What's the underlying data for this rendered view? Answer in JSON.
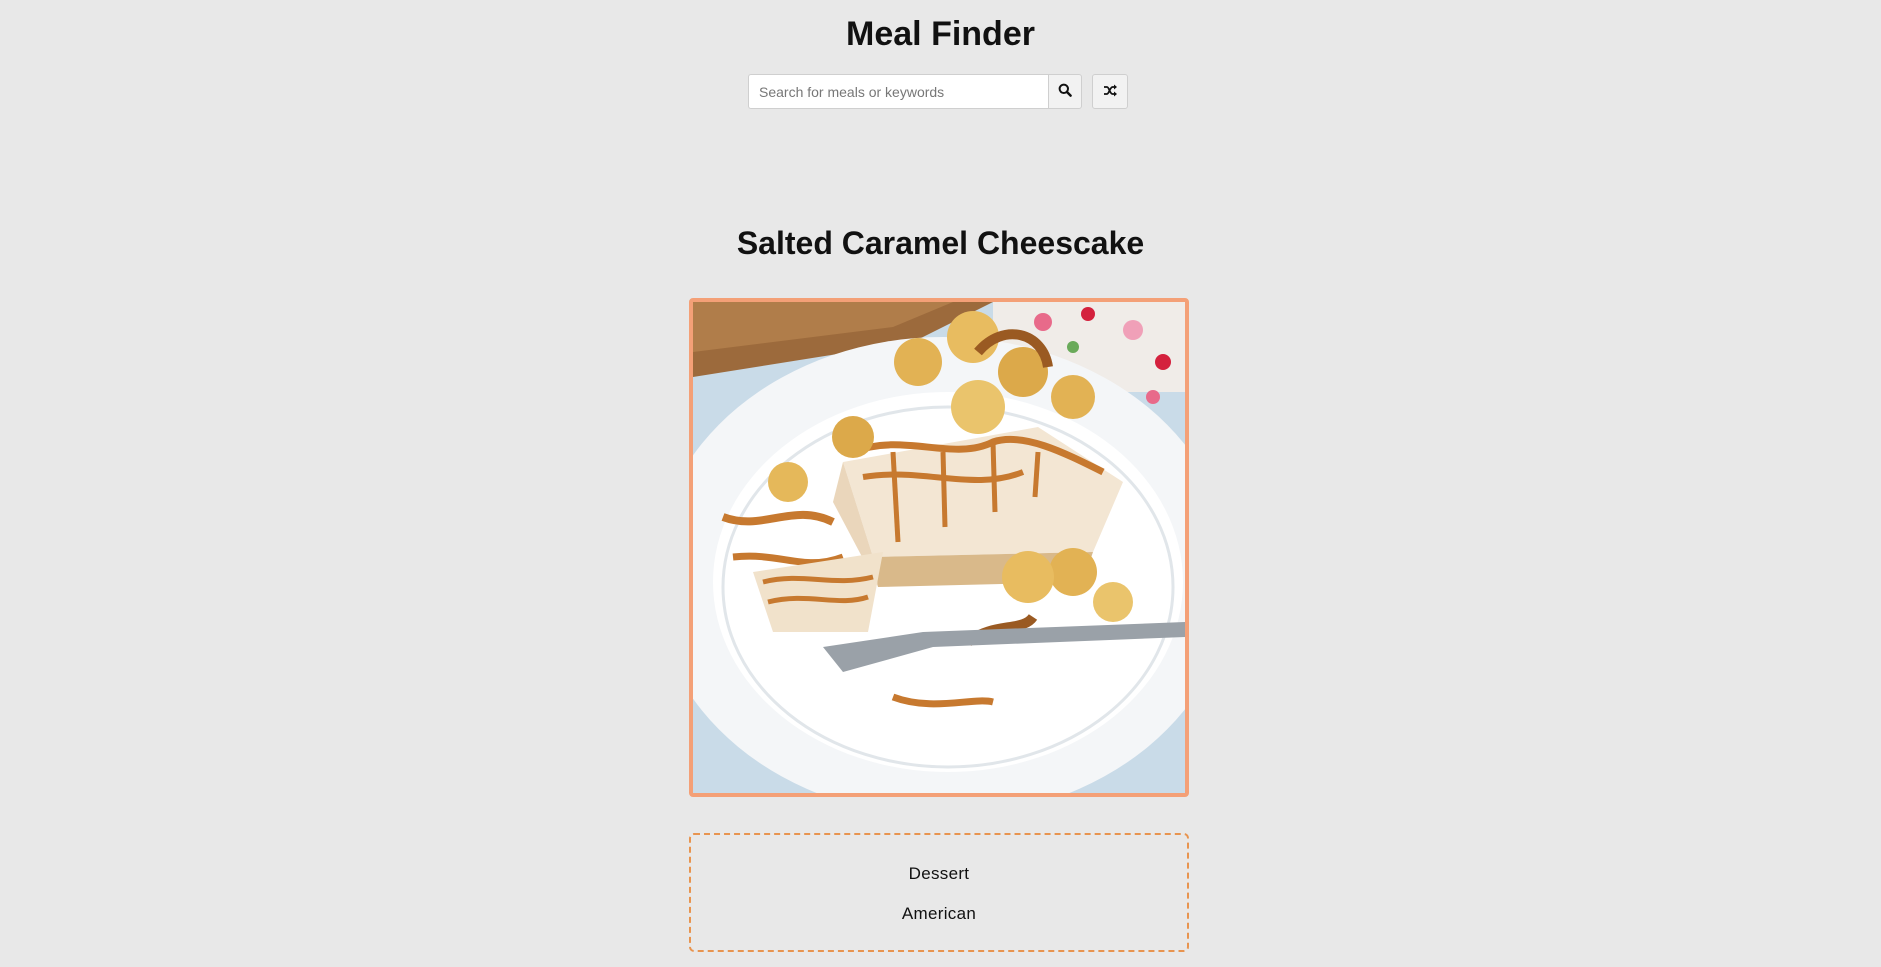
{
  "header": {
    "title": "Meal Finder"
  },
  "search": {
    "placeholder": "Search for meals or keywords",
    "value": "",
    "search_icon": "search-icon",
    "random_icon": "shuffle-icon"
  },
  "meal": {
    "name": "Salted Caramel Cheescake",
    "image_alt": "Salted Caramel Cheescake",
    "category": "Dessert",
    "area": "American"
  },
  "colors": {
    "background": "#e8e8e8",
    "image_border": "#f4a077",
    "info_border": "#e8944f"
  }
}
